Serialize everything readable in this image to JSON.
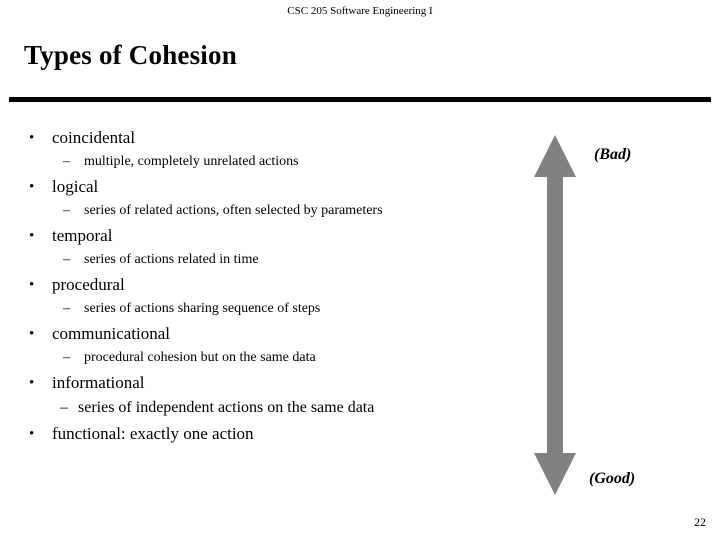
{
  "header": {
    "course": "CSC 205 Software Engineering I"
  },
  "title": "Types of Cohesion",
  "bullets": [
    {
      "level1": "coincidental",
      "level2": "multiple, completely unrelated actions"
    },
    {
      "level1": "logical",
      "level2": "series of related actions, often selected by parameters"
    },
    {
      "level1": "temporal",
      "level2": "series of actions related in time"
    },
    {
      "level1": "procedural",
      "level2": "series of actions sharing sequence of steps"
    },
    {
      "level1": "communicational",
      "level2": "procedural cohesion but on the same data"
    },
    {
      "level1": "informational",
      "level2": "series of independent actions on the same data"
    },
    {
      "level1": "functional: exactly one action",
      "level2": ""
    }
  ],
  "bullet_glyph": "•",
  "dash_glyph": "–",
  "arrow": {
    "name": "double-headed-vertical-arrow",
    "color": "#808080",
    "top_label": "(Bad)",
    "bottom_label": "(Good)"
  },
  "footer": {
    "page_number": "22"
  }
}
